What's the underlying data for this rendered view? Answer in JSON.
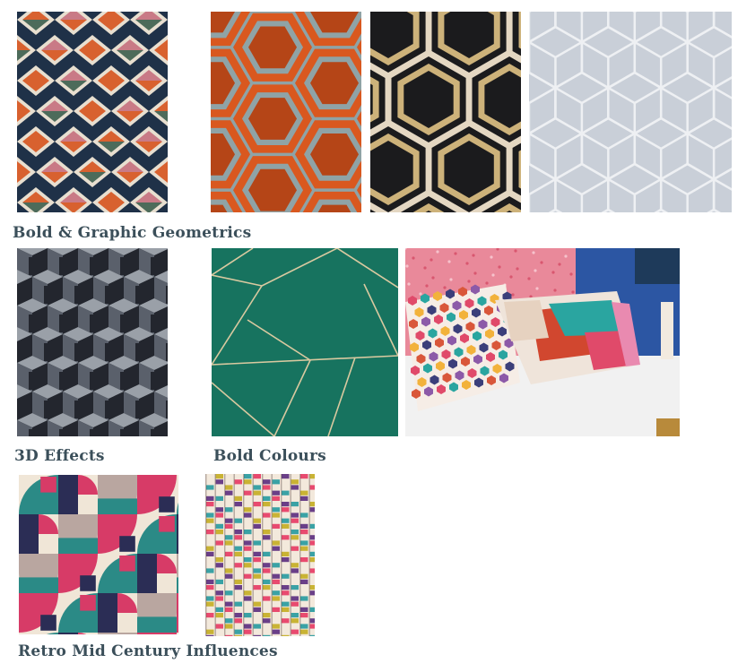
{
  "sections": [
    {
      "caption": "Bold & Graphic Geometrics"
    },
    {
      "caption": "3D Effects"
    },
    {
      "caption": "Bold Colours"
    },
    {
      "caption": "Retro Mid Century Influences"
    }
  ],
  "swatches": [
    {
      "subject": "diamond-triangle weave",
      "colors": [
        "#1f3148",
        "#d8612f",
        "#e8dfd0",
        "#c97a86",
        "#4d6b5a"
      ]
    },
    {
      "subject": "orange hexagon",
      "colors": [
        "#d9581f",
        "#8fa3a6",
        "#b54517"
      ]
    },
    {
      "subject": "black gold hexagon",
      "colors": [
        "#1b1b1d",
        "#cdb27a",
        "#e4d7c2"
      ]
    },
    {
      "subject": "grey cube trellis",
      "colors": [
        "#c9cfd8",
        "#e6e9ee"
      ]
    },
    {
      "subject": "3D block weave",
      "colors": [
        "#23262e",
        "#9aa0a8",
        "#5a606b"
      ]
    },
    {
      "subject": "green geometric lines",
      "colors": [
        "#17735f",
        "#d9c9a0"
      ]
    },
    {
      "subject": "cushions on bed",
      "colors": [
        "#e9899a",
        "#2c56a3",
        "#f1f1f1",
        "#e04a6a",
        "#2aa5a0"
      ]
    },
    {
      "subject": "retro abstract",
      "colors": [
        "#2b8a86",
        "#d73b67",
        "#f0e6d7",
        "#2b2d55",
        "#b9a6a0"
      ]
    },
    {
      "subject": "striped curtain",
      "colors": [
        "#e84a6f",
        "#f3e9dc",
        "#3aa2a5",
        "#c9b334",
        "#6a3f88"
      ]
    }
  ]
}
